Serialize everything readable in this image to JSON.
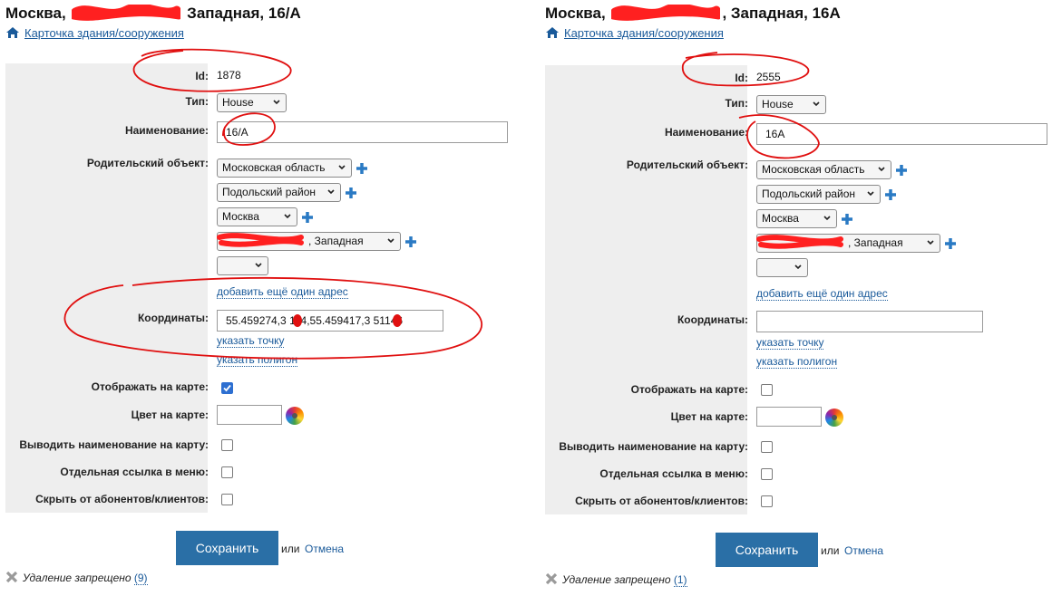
{
  "colors": {
    "accent": "#2a6fa6",
    "link": "#1a5a9a",
    "panel_gray": "#eeeeee",
    "annotation_red": "#e01010"
  },
  "left": {
    "title_prefix": "Москва,",
    "title_suffix": "Западная, 16/А",
    "breadcrumb": "Карточка здания/сооружения",
    "labels": {
      "id": "Id:",
      "type": "Тип:",
      "name": "Наименование:",
      "parent": "Родительский объект:",
      "coords": "Координаты:",
      "show_on_map": "Отображать на карте:",
      "map_color": "Цвет на карте:",
      "show_name": "Выводить наименование на карту:",
      "menu_link": "Отдельная ссылка в меню:",
      "hide_clients": "Скрыть от абонентов/клиентов:"
    },
    "id_value": "1878",
    "type_value": "House",
    "name_value": "16/А",
    "parents": [
      "Московская область",
      "Подольский район",
      "Москва",
      ", Западная",
      ""
    ],
    "add_address": "добавить ещё один адрес",
    "coords_value": "55.459274,3  114,55.459417,3  51146",
    "set_point": "указать точку",
    "set_polygon": "указать полигон",
    "show_on_map_checked": true,
    "save": "Сохранить",
    "or": "или",
    "cancel": "Отмена",
    "delete_text": "Удаление запрещено",
    "delete_count": "(9)"
  },
  "right": {
    "title_prefix": "Москва,",
    "title_suffix": ", Западная, 16А",
    "breadcrumb": "Карточка здания/сооружения",
    "labels": {
      "id": "Id:",
      "type": "Тип:",
      "name": "Наименование:",
      "parent": "Родительский объект:",
      "coords": "Координаты:",
      "show_on_map": "Отображать на карте:",
      "map_color": "Цвет на карте:",
      "show_name": "Выводить наименование на карту:",
      "menu_link": "Отдельная ссылка в меню:",
      "hide_clients": "Скрыть от абонентов/клиентов:"
    },
    "id_value": "2555",
    "type_value": "House",
    "name_value": "16А",
    "parents": [
      "Московская область",
      "Подольский район",
      "Москва",
      ", Западная",
      ""
    ],
    "add_address": "добавить ещё один адрес",
    "coords_value": "",
    "set_point": "указать точку",
    "set_polygon": "указать полигон",
    "show_on_map_checked": false,
    "save": "Сохранить",
    "or": "или",
    "cancel": "Отмена",
    "delete_text": "Удаление запрещено",
    "delete_count": "(1)"
  }
}
